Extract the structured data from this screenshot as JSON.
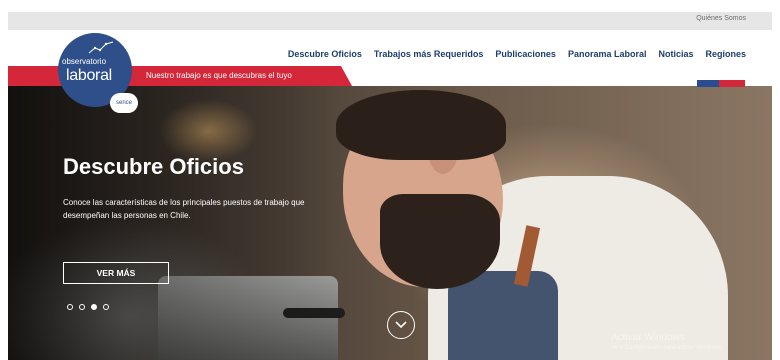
{
  "utility_nav": {
    "link_label": "Quiénes Somos"
  },
  "logo": {
    "line1": "observatorio",
    "line2": "laboral",
    "partner": "sence"
  },
  "banner": {
    "tagline": "Nuestro trabajo es que descubras el tuyo"
  },
  "main_nav": {
    "items": [
      {
        "label": "Descubre Oficios"
      },
      {
        "label": "Trabajos más Requeridos"
      },
      {
        "label": "Publicaciones"
      },
      {
        "label": "Panorama Laboral"
      },
      {
        "label": "Noticias"
      },
      {
        "label": "Regiones"
      }
    ]
  },
  "hero": {
    "title": "Descubre Oficios",
    "description": "Conoce las características de los principales puestos de trabajo que desempeñan las personas en Chile.",
    "button_label": "VER MÁS",
    "slides_count": 4,
    "active_slide": 3
  },
  "watermark": {
    "title": "Activar Windows",
    "subtitle": "Ve a Configuración para activar Windows."
  },
  "colors": {
    "brand_blue": "#2e4f8a",
    "nav_text": "#1e3e6e",
    "brand_red": "#d4283a",
    "utility_bar": "#e6e6e6"
  },
  "icons": {
    "scroll": "chevron-down-icon",
    "logo_graphic": "line-chart-icon"
  }
}
